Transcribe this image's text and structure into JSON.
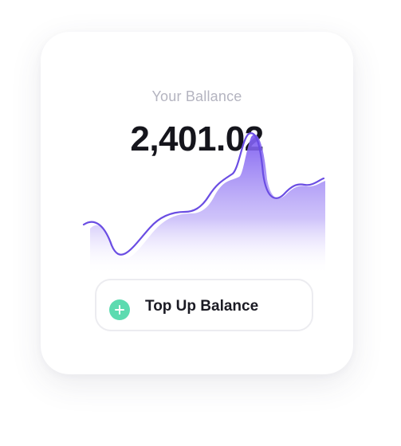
{
  "balance": {
    "label": "Your Ballance",
    "amount": "2,401.02"
  },
  "action": {
    "label": "Top Up Balance",
    "icon": "plus-icon",
    "icon_color": "#5ddbb0"
  },
  "colors": {
    "chart_line": "#6a4de3",
    "chart_fill_top": "#7b5af0"
  }
}
